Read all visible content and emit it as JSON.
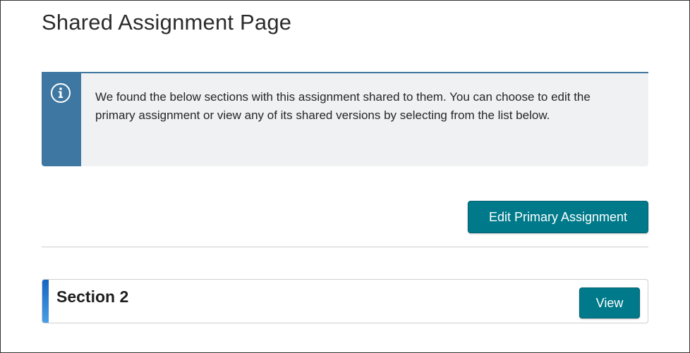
{
  "page": {
    "title": "Shared Assignment Page"
  },
  "info_box": {
    "icon": "info-icon",
    "message": "We found the below sections with this assignment shared to them. You can choose to edit the primary assignment or view any of its shared versions by selecting from the list below."
  },
  "actions": {
    "edit_primary_label": "Edit Primary Assignment"
  },
  "sections": [
    {
      "name": "Section 2",
      "view_label": "View"
    }
  ],
  "colors": {
    "accent": "#007a8a",
    "info_rail": "#3e77a1",
    "info_background": "#eff1f2"
  }
}
